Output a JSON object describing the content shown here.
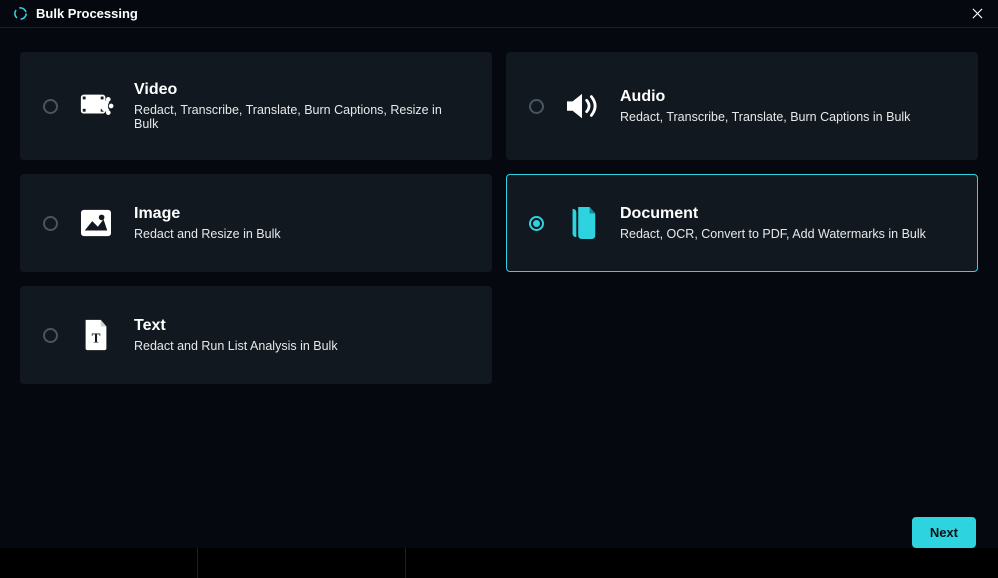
{
  "titlebar": {
    "title": "Bulk Processing"
  },
  "options": {
    "video": {
      "title": "Video",
      "desc": "Redact, Transcribe, Translate, Burn Captions, Resize in Bulk"
    },
    "audio": {
      "title": "Audio",
      "desc": "Redact, Transcribe, Translate, Burn Captions in Bulk"
    },
    "image": {
      "title": "Image",
      "desc": "Redact and Resize in Bulk"
    },
    "document": {
      "title": "Document",
      "desc": "Redact, OCR, Convert to PDF, Add Watermarks in Bulk"
    },
    "text": {
      "title": "Text",
      "desc": "Redact and Run List Analysis in Bulk"
    }
  },
  "footer": {
    "next_label": "Next"
  }
}
